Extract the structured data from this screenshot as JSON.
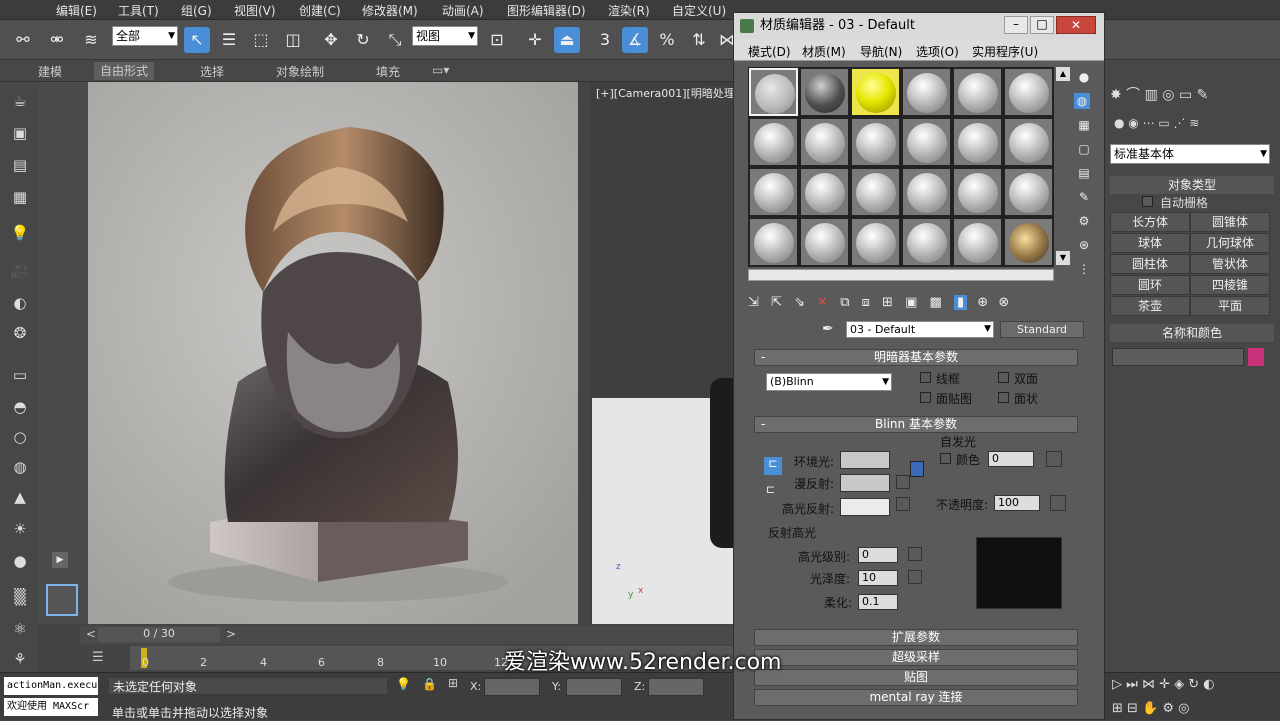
{
  "menu": {
    "items": [
      "编辑(E)",
      "工具(T)",
      "组(G)",
      "视图(V)",
      "创建(C)",
      "修改器(M)",
      "动画(A)",
      "图形编辑器(D)",
      "渲染(R)",
      "自定义(U)"
    ]
  },
  "toolbar": {
    "selection_filter": "全部",
    "ref_coord": "视图"
  },
  "ribbon": {
    "tabs": [
      "建模",
      "自由形式",
      "选择",
      "对象绘制",
      "填充"
    ]
  },
  "viewport": {
    "label": "[+][Camera001][明暗处理",
    "frame_counter": "0 / 30",
    "axis_z": "z",
    "axis_x": "x",
    "axis_y": "y"
  },
  "ruler_ticks": [
    "0",
    "2",
    "4",
    "6",
    "8",
    "10",
    "12"
  ],
  "status": {
    "listener1": "actionMan.execu",
    "listener2": "欢迎使用 MAXScr",
    "line1": "未选定任何对象",
    "line2": "单击或单击并拖动以选择对象",
    "x_label": "X:",
    "y_label": "Y:",
    "z_label": "Z:"
  },
  "watermark": "爱渲染www.52render.com",
  "mat_editor": {
    "title": "材质编辑器 - 03 - Default",
    "menu": [
      "模式(D)",
      "材质(M)",
      "导航(N)",
      "选项(O)",
      "实用程序(U)"
    ],
    "material_name": "03 - Default",
    "material_type": "Standard",
    "shader_rollout": "明暗器基本参数",
    "shader": "(B)Blinn",
    "check_wire": "线框",
    "check_2side": "双面",
    "check_facemap": "面贴图",
    "check_faceted": "面状",
    "blinn_rollout": "Blinn 基本参数",
    "self_illum": "自发光",
    "color_label": "颜色",
    "color_value": "0",
    "ambient": "环境光:",
    "diffuse": "漫反射:",
    "specular": "高光反射:",
    "opacity_label": "不透明度:",
    "opacity_value": "100",
    "spec_highlights": "反射高光",
    "spec_level_label": "高光级别:",
    "spec_level": "0",
    "gloss_label": "光泽度:",
    "gloss": "10",
    "soften_label": "柔化:",
    "soften": "0.1",
    "rollouts": [
      "扩展参数",
      "超级采样",
      "贴图",
      "mental ray 连接"
    ]
  },
  "right_panel": {
    "dropdown": "标准基本体",
    "object_type": "对象类型",
    "autogrid": "自动栅格",
    "buttons": [
      "长方体",
      "圆锥体",
      "球体",
      "几何球体",
      "圆柱体",
      "管状体",
      "圆环",
      "四棱锥",
      "茶壶",
      "平面"
    ],
    "name_color": "名称和颜色",
    "color_swatch": "#c8327a"
  }
}
